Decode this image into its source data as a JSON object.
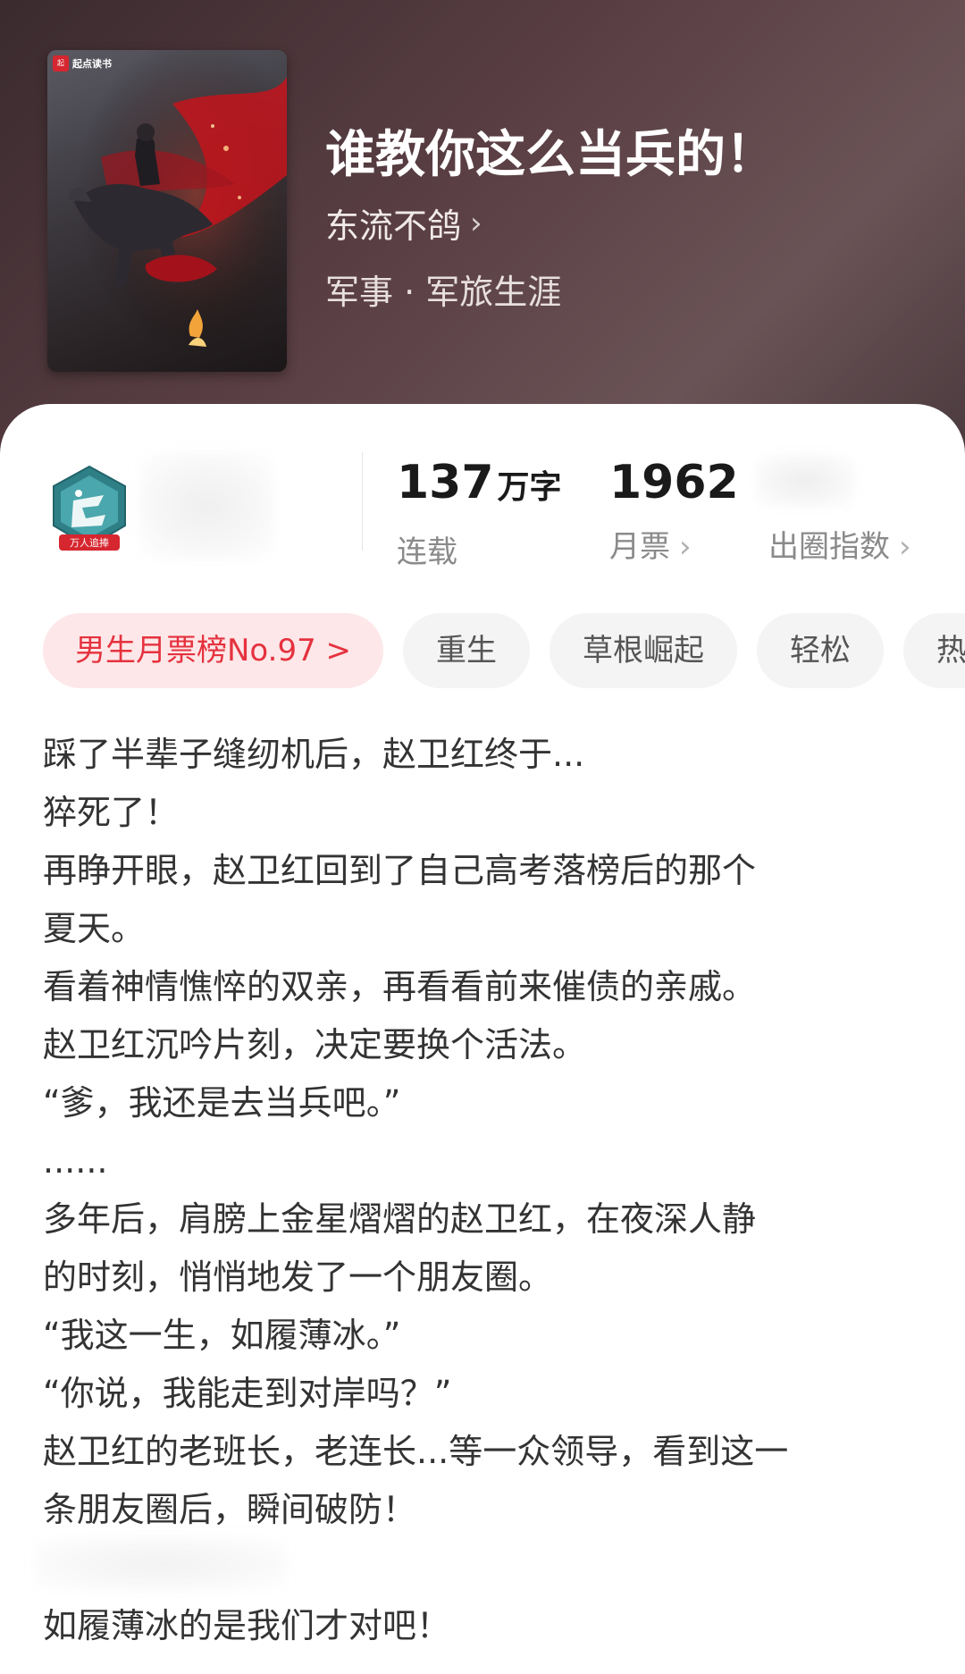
{
  "book": {
    "title": "谁教你这么当兵的！",
    "author": "东流不鸽",
    "category": "军事 · 军旅生涯",
    "cover_brand": "起点读书"
  },
  "badge": {
    "label": "万人追捧"
  },
  "stats": {
    "words": {
      "value": "137",
      "unit": "万字",
      "label": "连载"
    },
    "monthly_votes": {
      "value": "1962",
      "label": "月票"
    },
    "index": {
      "label": "出圈指数"
    }
  },
  "tags": [
    "男生月票榜No.97 >",
    "重生",
    "草根崛起",
    "轻松",
    "热"
  ],
  "description": [
    "踩了半辈子缝纫机后，赵卫红终于...",
    "猝死了！",
    "再睁开眼，赵卫红回到了自己高考落榜后的那个",
    "夏天。",
    "看着神情憔悴的双亲，再看看前来催债的亲戚。",
    "赵卫红沉吟片刻，决定要换个活法。",
    "“爹，我还是去当兵吧。”",
    "......",
    "多年后，肩膀上金星熠熠的赵卫红，在夜深人静",
    "的时刻，悄悄地发了一个朋友圈。",
    "“我这一生，如履薄冰。”",
    "“你说，我能走到对岸吗？”",
    "赵卫红的老班长，老连长...等一众领导，看到这一",
    "条朋友圈后，瞬间破防！",
    "",
    "如履薄冰的是我们才对吧！"
  ],
  "colors": {
    "header_bg": "#4a3a3e",
    "rank_tag_bg": "#fde7e8",
    "rank_tag_text": "#e5323e",
    "tag_bg": "#f4f4f4"
  }
}
